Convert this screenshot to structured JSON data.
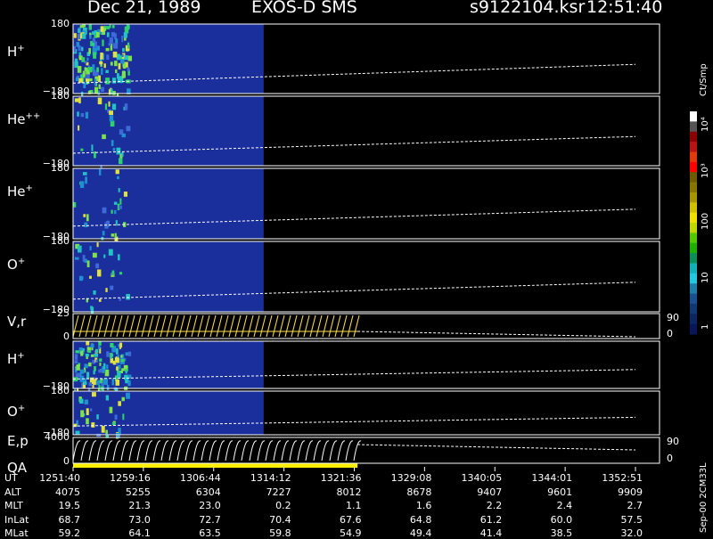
{
  "header": {
    "date": "Dec 21, 1989",
    "instrument": "EXOS-D SMS",
    "file": "s9122104.ksr",
    "time": "12:51:40"
  },
  "colorbar": {
    "unit": "Ct/Smp",
    "ticks": [
      "10⁴",
      "10³",
      "100",
      "10",
      "1"
    ]
  },
  "footer_note": "Sep-00  2CM33L",
  "colors": {
    "background": "#000000",
    "field": "#1a2e9c",
    "trace": "#ffffff",
    "qa": "#ffee00",
    "vr_trace": "#ffe14a"
  },
  "chart_data": {
    "type": "heatmap",
    "panels": [
      {
        "id": "H+",
        "label": "H",
        "sup": "+",
        "ymax": "180",
        "ymin": "−180",
        "data_extent_frac": 0.67,
        "line_y_start": 0.85,
        "line_y_end": 0.58
      },
      {
        "id": "He++",
        "label": "He",
        "sup": "++",
        "ymax": "180",
        "ymin": "−180",
        "data_extent_frac": 0.67,
        "line_y_start": 0.82,
        "line_y_end": 0.58
      },
      {
        "id": "He+",
        "label": "He",
        "sup": "+",
        "ymax": "180",
        "ymin": "−180",
        "data_extent_frac": 0.67,
        "line_y_start": 0.82,
        "line_y_end": 0.58
      },
      {
        "id": "O+",
        "label": "O",
        "sup": "+",
        "ymax": "180",
        "ymin": "−180",
        "data_extent_frac": 0.67,
        "line_y_start": 0.82,
        "line_y_end": 0.58
      },
      {
        "id": "V,r",
        "label": "V,r",
        "sup": "",
        "ymax": "25",
        "ymin": "0",
        "rmax": "90",
        "rmin": "0"
      },
      {
        "id": "H+2",
        "label": "H",
        "sup": "+",
        "ymax": "",
        "ymin": "−180",
        "data_extent_frac": 0.67,
        "line_y_start": 0.8,
        "line_y_end": 0.6
      },
      {
        "id": "O+2",
        "label": "O",
        "sup": "+",
        "ymax": "180",
        "ymin": "−180",
        "data_extent_frac": 0.67,
        "line_y_start": 0.8,
        "line_y_end": 0.6
      },
      {
        "id": "E,p",
        "label": "E,p",
        "sup": "",
        "ymax": "4000",
        "ymin": "0",
        "rmax": "90",
        "rmin": "0",
        "label2": "QA"
      }
    ],
    "table": {
      "rows": [
        {
          "label": "UT",
          "values": [
            "1251:40",
            "1259:16",
            "1306:44",
            "1314:12",
            "1321:36",
            "1329:08",
            "1340:05",
            "1344:01",
            "1352:51"
          ]
        },
        {
          "label": "ALT",
          "values": [
            "4075",
            "5255",
            "6304",
            "7227",
            "8012",
            "8678",
            "9407",
            "9601",
            "9909"
          ]
        },
        {
          "label": "MLT",
          "values": [
            "19.5",
            "21.3",
            "23.0",
            "0.2",
            "1.1",
            "1.6",
            "2.2",
            "2.4",
            "2.7"
          ]
        },
        {
          "label": "InLat",
          "values": [
            "68.7",
            "73.0",
            "72.7",
            "70.4",
            "67.6",
            "64.8",
            "61.2",
            "60.0",
            "57.5"
          ]
        },
        {
          "label": "MLat",
          "values": [
            "59.2",
            "64.1",
            "63.5",
            "59.8",
            "54.9",
            "49.4",
            "41.4",
            "38.5",
            "32.0"
          ]
        }
      ]
    }
  }
}
